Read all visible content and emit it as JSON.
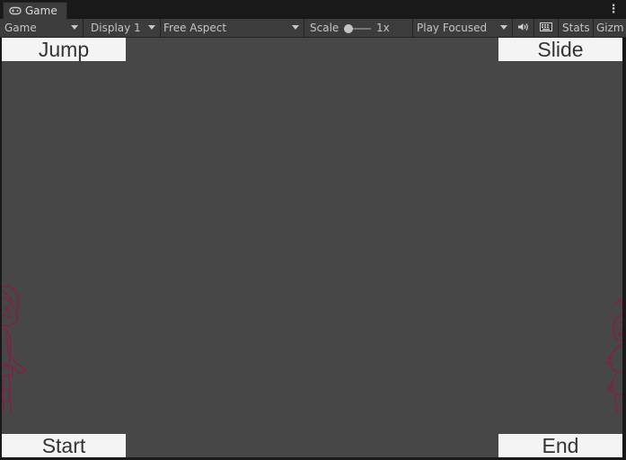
{
  "tab": {
    "label": "Game",
    "icon": "gamepad-icon"
  },
  "toolbar": {
    "view_select": "Game",
    "display_select": "Display 1",
    "aspect_select": "Free Aspect",
    "scale_label": "Scale",
    "scale_value": "1x",
    "scale_level": 0,
    "play_mode_select": "Play Focused",
    "audio_icon": "speaker-icon",
    "keyboard_icon": "keyboard-icon",
    "stats_label": "Stats",
    "gizmos_label": "Gizm"
  },
  "game": {
    "jump_label": "Jump",
    "slide_label": "Slide",
    "start_label": "Start",
    "end_label": "End"
  },
  "colors": {
    "viewport": "#474747",
    "toolbar": "#3c3c3c",
    "button": "#f4f4f4",
    "sprite_outline": "#8b1a48"
  }
}
